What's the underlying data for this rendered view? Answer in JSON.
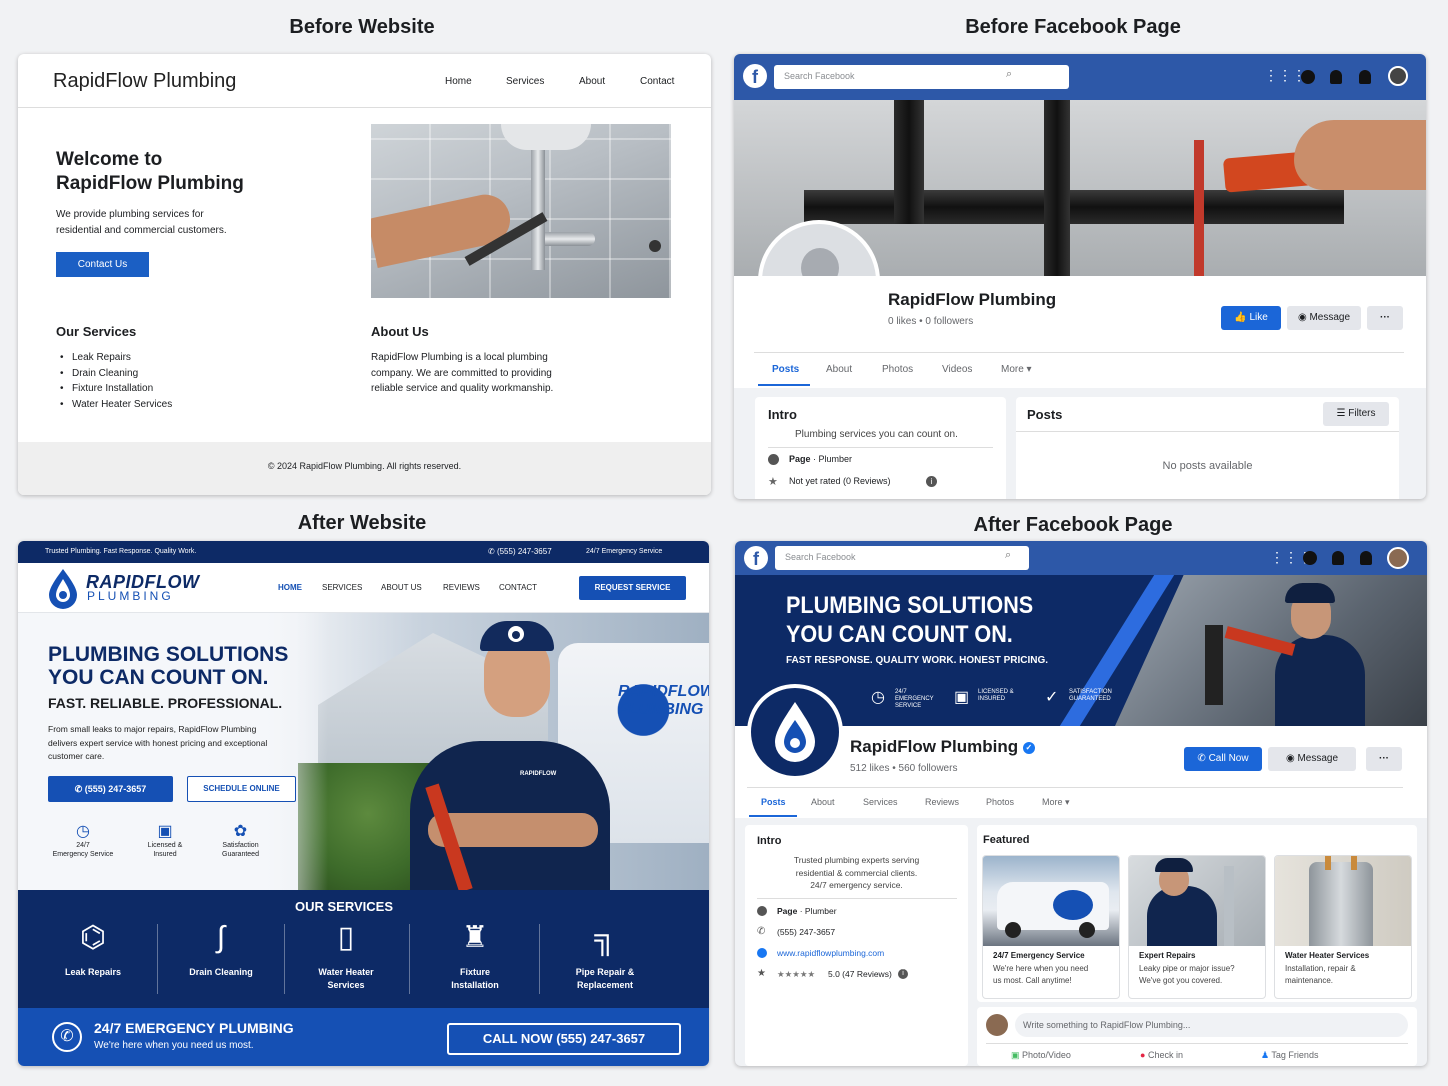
{
  "titles": {
    "before_website": "Before Website",
    "before_fb": "Before Facebook Page",
    "after_website": "After Website",
    "after_fb": "After Facebook Page"
  },
  "bw": {
    "brand": "RapidFlow Plumbing",
    "nav": [
      "Home",
      "Services",
      "About",
      "Contact"
    ],
    "hero_line1": "Welcome to",
    "hero_line2": "RapidFlow Plumbing",
    "intro_1": "We provide plumbing services for",
    "intro_2": "residential and commercial customers.",
    "cta": "Contact Us",
    "services_title": "Our Services",
    "services": [
      "Leak Repairs",
      "Drain Cleaning",
      "Fixture Installation",
      "Water Heater Services"
    ],
    "about_title": "About Us",
    "about_1": "RapidFlow Plumbing is a local plumbing",
    "about_2": "company. We are committed to providing",
    "about_3": "reliable service and quality workmanship.",
    "footer": "© 2024 RapidFlow Plumbing. All rights reserved."
  },
  "bf": {
    "search_placeholder": "Search Facebook",
    "page_name": "RapidFlow Plumbing",
    "stats": "0 likes • 0 followers",
    "like": "Like",
    "message": "Message",
    "more_dots": "···",
    "tabs": [
      "Posts",
      "About",
      "Photos",
      "Videos",
      "More ▾"
    ],
    "intro_title": "Intro",
    "intro_text": "Plumbing services you can count on.",
    "page_label": "Page",
    "page_type": " · Plumber",
    "rating": "Not yet rated (0 Reviews)",
    "posts_title": "Posts",
    "filters": "Filters",
    "no_posts": "No posts available"
  },
  "aw": {
    "topbar_left": "Trusted Plumbing. Fast Response. Quality Work.",
    "topbar_phone": "(555) 247-3657",
    "topbar_right": "24/7 Emergency Service",
    "logo_top": "RAPIDFLOW",
    "logo_bottom": "PLUMBING",
    "nav": [
      "HOME",
      "SERVICES",
      "ABOUT US",
      "REVIEWS",
      "CONTACT"
    ],
    "request": "REQUEST SERVICE",
    "hero_1": "PLUMBING SOLUTIONS",
    "hero_2": "YOU CAN COUNT ON.",
    "hero_sub": "FAST. RELIABLE. PROFESSIONAL.",
    "hero_p1": "From small leaks to major repairs, RapidFlow Plumbing",
    "hero_p2": "delivers expert service with honest pricing and exceptional",
    "hero_p3": "customer care.",
    "call_btn": "(555) 247-3657",
    "schedule_btn": "SCHEDULE ONLINE",
    "badges": [
      {
        "l1": "24/7",
        "l2": "Emergency Service"
      },
      {
        "l1": "Licensed &",
        "l2": "Insured"
      },
      {
        "l1": "Satisfaction",
        "l2": "Guaranteed"
      }
    ],
    "van_text": "RAPIDFLOW PLUMBING",
    "shirt_logo": "RAPIDFLOW",
    "services_title": "OUR SERVICES",
    "services": [
      {
        "l1": "Leak Repairs",
        "l2": ""
      },
      {
        "l1": "Drain Cleaning",
        "l2": ""
      },
      {
        "l1": "Water Heater",
        "l2": "Services"
      },
      {
        "l1": "Fixture",
        "l2": "Installation"
      },
      {
        "l1": "Pipe Repair &",
        "l2": "Replacement"
      }
    ],
    "emerg_title": "24/7 EMERGENCY PLUMBING",
    "emerg_sub": "We're here when you need us most.",
    "call_now": "CALL NOW  (555) 247-3657"
  },
  "af": {
    "search_placeholder": "Search Facebook",
    "cover_1": "PLUMBING SOLUTIONS",
    "cover_2": "YOU CAN COUNT ON.",
    "cover_sub": "FAST RESPONSE. QUALITY WORK. HONEST PRICING.",
    "badges": [
      {
        "l1": "24/7",
        "l2": "EMERGENCY",
        "l3": "SERVICE"
      },
      {
        "l1": "LICENSED &",
        "l2": "INSURED",
        "l3": ""
      },
      {
        "l1": "SATISFACTION",
        "l2": "GUARANTEED",
        "l3": ""
      }
    ],
    "page_name": "RapidFlow Plumbing",
    "stats": "512 likes • 560 followers",
    "call_now": "Call Now",
    "message": "Message",
    "more_dots": "···",
    "tabs": [
      "Posts",
      "About",
      "Services",
      "Reviews",
      "Photos",
      "More ▾"
    ],
    "intro_title": "Intro",
    "intro_1": "Trusted plumbing experts serving",
    "intro_2": "residential & commercial clients.",
    "intro_3": "24/7 emergency service.",
    "page_label": "Page",
    "page_type": " · Plumber",
    "phone": "(555) 247-3657",
    "website": "www.rapidflowplumbing.com",
    "stars": "★★★★★",
    "rating": "5.0 (47 Reviews)",
    "featured_title": "Featured",
    "featured": [
      {
        "title": "24/7 Emergency Service",
        "d1": "We're here when you need",
        "d2": "us most. Call anytime!"
      },
      {
        "title": "Expert Repairs",
        "d1": "Leaky pipe or major issue?",
        "d2": "We've got you covered."
      },
      {
        "title": "Water Heater Services",
        "d1": "Installation, repair &",
        "d2": "maintenance."
      }
    ],
    "composer": "Write something to RapidFlow Plumbing...",
    "actions": [
      "Photo/Video",
      "Check in",
      "Tag Friends"
    ]
  },
  "colors": {
    "fb_blue": "#2d58a8",
    "brand_navy": "#0d2a66",
    "brand_blue": "#1550b4",
    "accent": "#1877f2"
  }
}
